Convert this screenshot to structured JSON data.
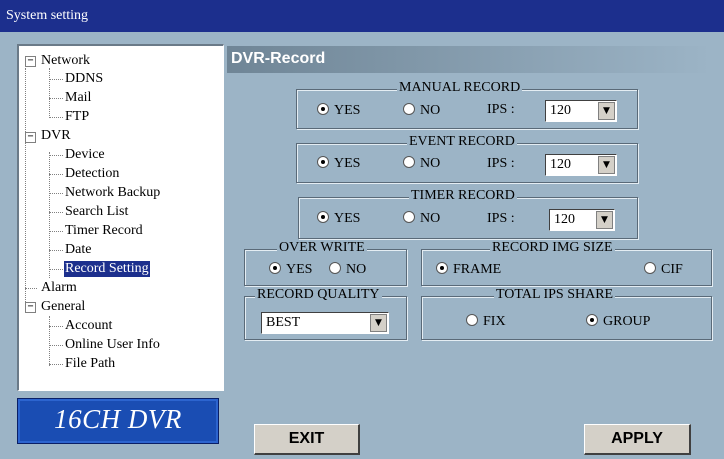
{
  "window": {
    "title": "System setting"
  },
  "tree": {
    "network": {
      "label": "Network",
      "children": [
        "DDNS",
        "Mail",
        "FTP"
      ]
    },
    "dvr": {
      "label": "DVR",
      "children": [
        "Device",
        "Detection",
        "Network Backup",
        "Search List",
        "Timer Record",
        "Date",
        "Record Setting"
      ]
    },
    "alarm": {
      "label": "Alarm"
    },
    "general": {
      "label": "General",
      "children": [
        "Account",
        "Online User Info",
        "File Path"
      ]
    },
    "selected": "Record Setting"
  },
  "logo": {
    "text": "16CH DVR"
  },
  "panel": {
    "title": "DVR-Record",
    "manual_record": {
      "legend": "MANUAL RECORD",
      "yes_label": "YES",
      "no_label": "NO",
      "selected": "YES",
      "ips_label": "IPS :",
      "ips_value": "120"
    },
    "event_record": {
      "legend": "EVENT RECORD",
      "yes_label": "YES",
      "no_label": "NO",
      "selected": "YES",
      "ips_label": "IPS :",
      "ips_value": "120"
    },
    "timer_record": {
      "legend": "TIMER RECORD",
      "yes_label": "YES",
      "no_label": "NO",
      "selected": "YES",
      "ips_label": "IPS :",
      "ips_value": "120"
    },
    "over_write": {
      "legend": "OVER WRITE",
      "yes_label": "YES",
      "no_label": "NO",
      "selected": "YES"
    },
    "record_img_size": {
      "legend": "RECORD IMG SIZE",
      "frame_label": "FRAME",
      "cif_label": "CIF",
      "selected": "FRAME"
    },
    "record_quality": {
      "legend": "RECORD QUALITY",
      "value": "BEST"
    },
    "total_ips_share": {
      "legend": "TOTAL IPS SHARE",
      "fix_label": "FIX",
      "group_label": "GROUP",
      "selected": "GROUP"
    }
  },
  "buttons": {
    "exit": "EXIT",
    "apply": "APPLY"
  },
  "colors": {
    "title_bar": "#1c2f8d",
    "panel_bg": "#9cb4c6",
    "logo_bg": "#1a4db3"
  },
  "icons": {
    "expand": "minus-icon",
    "dropdown": "dropdown-arrow-icon"
  }
}
